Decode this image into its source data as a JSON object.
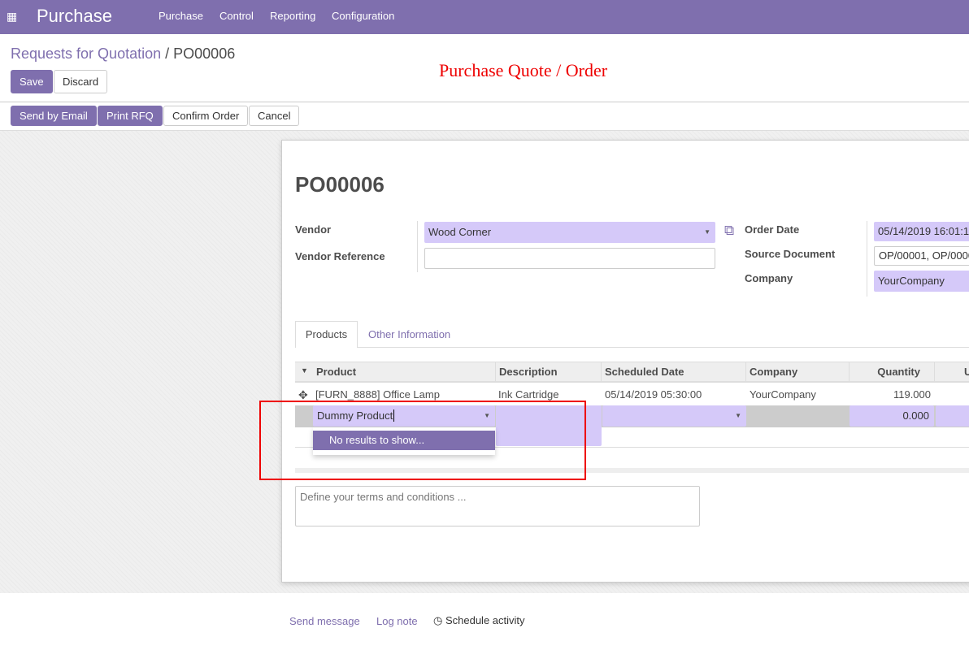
{
  "nav": {
    "app_title": "Purchase",
    "menu": [
      "Purchase",
      "Control",
      "Reporting",
      "Configuration"
    ]
  },
  "breadcrumb": {
    "parent": "Requests for Quotation",
    "separator": "/",
    "current": "PO00006"
  },
  "annotation": "Purchase Quote / Order",
  "buttons": {
    "save": "Save",
    "discard": "Discard",
    "send_email": "Send by Email",
    "print_rfq": "Print RFQ",
    "confirm": "Confirm Order",
    "cancel": "Cancel"
  },
  "form": {
    "title": "PO00006",
    "vendor_label": "Vendor",
    "vendor": "Wood Corner",
    "vendor_ref_label": "Vendor Reference",
    "vendor_ref": "",
    "order_date_label": "Order Date",
    "order_date": "05/14/2019 16:01:1",
    "source_label": "Source Document",
    "source": "OP/00001, OP/0000",
    "company_label": "Company",
    "company": "YourCompany"
  },
  "tabs": [
    "Products",
    "Other Information"
  ],
  "table": {
    "headers": [
      "Product",
      "Description",
      "Scheduled Date",
      "Company",
      "Quantity",
      "U"
    ],
    "row": {
      "product": "[FURN_8888] Office Lamp",
      "description": "Ink Cartridge",
      "date": "05/14/2019 05:30:00",
      "company": "YourCompany",
      "quantity": "119.000"
    },
    "edit_row": {
      "product": "Dummy Product",
      "quantity": "0.000"
    },
    "dropdown": "No results to show..."
  },
  "terms_placeholder": "Define your terms and conditions ...",
  "chatter": {
    "send": "Send message",
    "log": "Log note",
    "schedule": "Schedule activity"
  }
}
